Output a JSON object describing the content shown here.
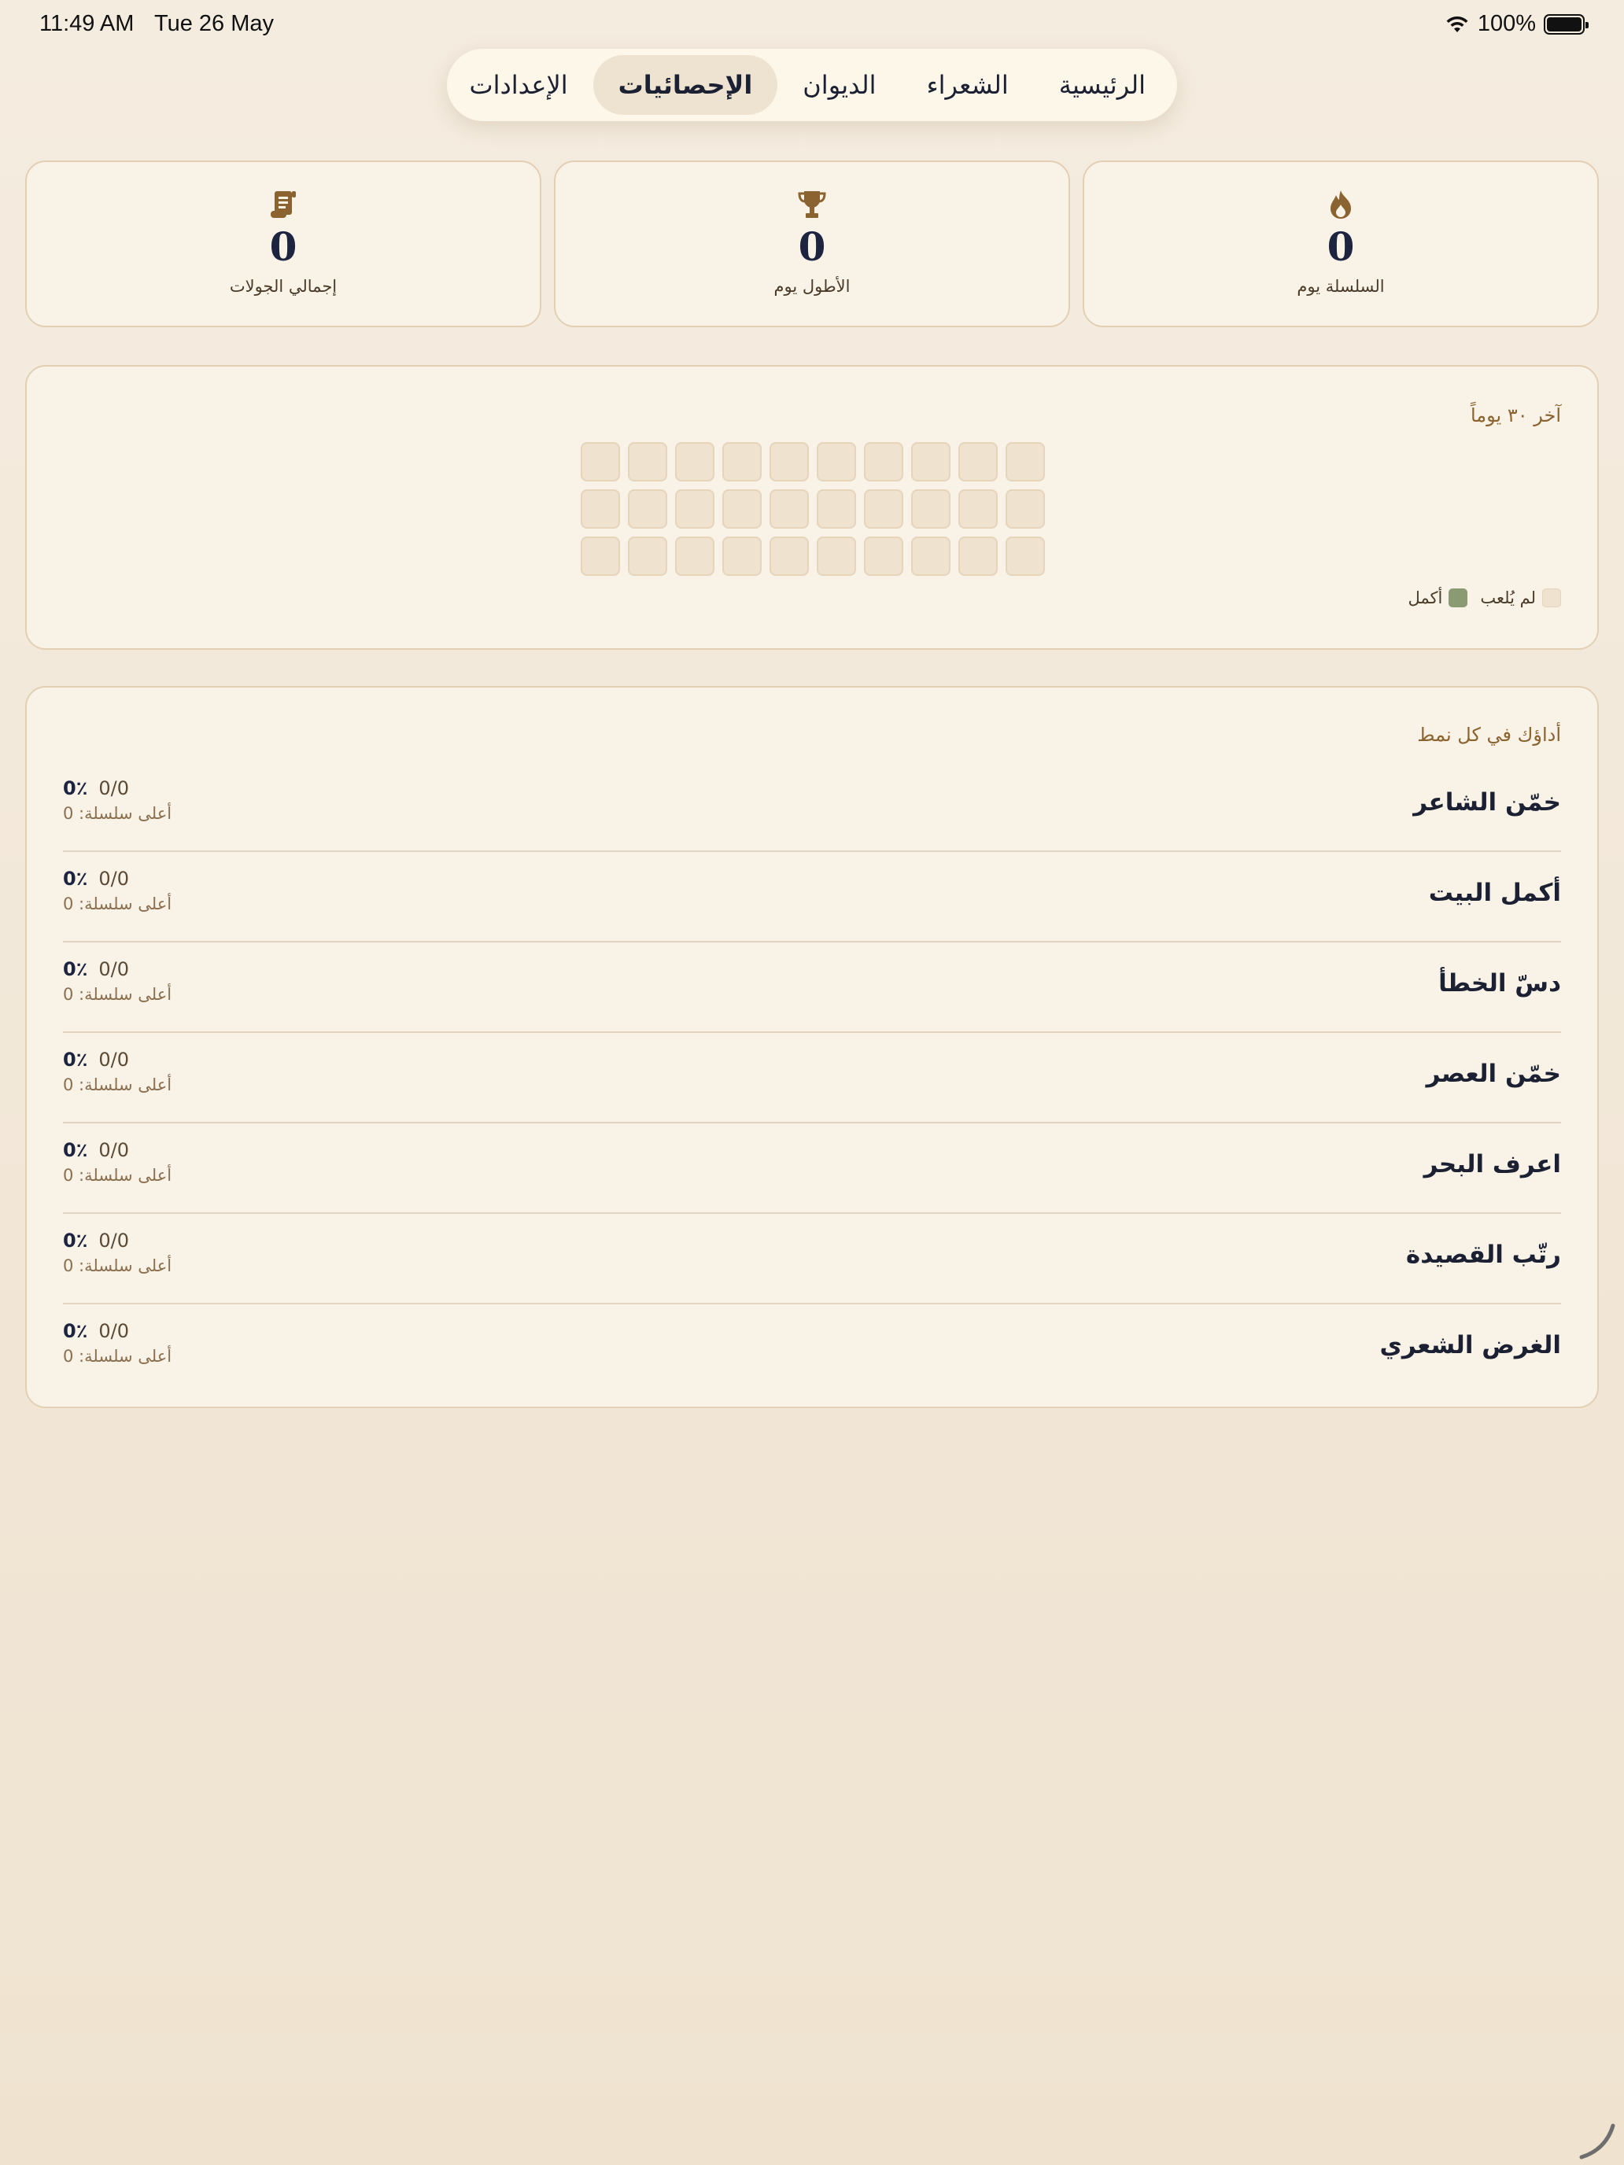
{
  "status_bar": {
    "time": "11:49 AM",
    "date": "Tue 26 May",
    "battery": "100%"
  },
  "nav": {
    "tabs": [
      {
        "label": "الرئيسية",
        "active": false
      },
      {
        "label": "الشعراء",
        "active": false
      },
      {
        "label": "الديوان",
        "active": false
      },
      {
        "label": "الإحصائيات",
        "active": true
      },
      {
        "label": "الإعدادات",
        "active": false
      }
    ]
  },
  "stats": [
    {
      "icon": "flame-icon",
      "value": "0",
      "label": "السلسلة يوم"
    },
    {
      "icon": "trophy-icon",
      "value": "0",
      "label": "الأطول يوم"
    },
    {
      "icon": "scroll-icon",
      "value": "0",
      "label": "إجمالي الجولات"
    }
  ],
  "activity": {
    "title": "آخر ٣٠ يوماً",
    "days_count": 30,
    "legend": {
      "not_played": "لم يُلعب",
      "completed": "أكمل"
    }
  },
  "modes": {
    "title": "أداؤك في كل نمط",
    "items": [
      {
        "name": "خمّن الشاعر",
        "percent": "0٪",
        "count": "0/0",
        "best": "أعلى سلسلة: 0"
      },
      {
        "name": "أكمل البيت",
        "percent": "0٪",
        "count": "0/0",
        "best": "أعلى سلسلة: 0"
      },
      {
        "name": "دسّ الخطأ",
        "percent": "0٪",
        "count": "0/0",
        "best": "أعلى سلسلة: 0"
      },
      {
        "name": "خمّن العصر",
        "percent": "0٪",
        "count": "0/0",
        "best": "أعلى سلسلة: 0"
      },
      {
        "name": "اعرف البحر",
        "percent": "0٪",
        "count": "0/0",
        "best": "أعلى سلسلة: 0"
      },
      {
        "name": "رتّب القصيدة",
        "percent": "0٪",
        "count": "0/0",
        "best": "أعلى سلسلة: 0"
      },
      {
        "name": "الغرض الشعري",
        "percent": "0٪",
        "count": "0/0",
        "best": "أعلى سلسلة: 0"
      }
    ]
  },
  "colors": {
    "accent": "#8b6330",
    "completed": "#8a9a72",
    "not_played": "#efe2cf"
  }
}
